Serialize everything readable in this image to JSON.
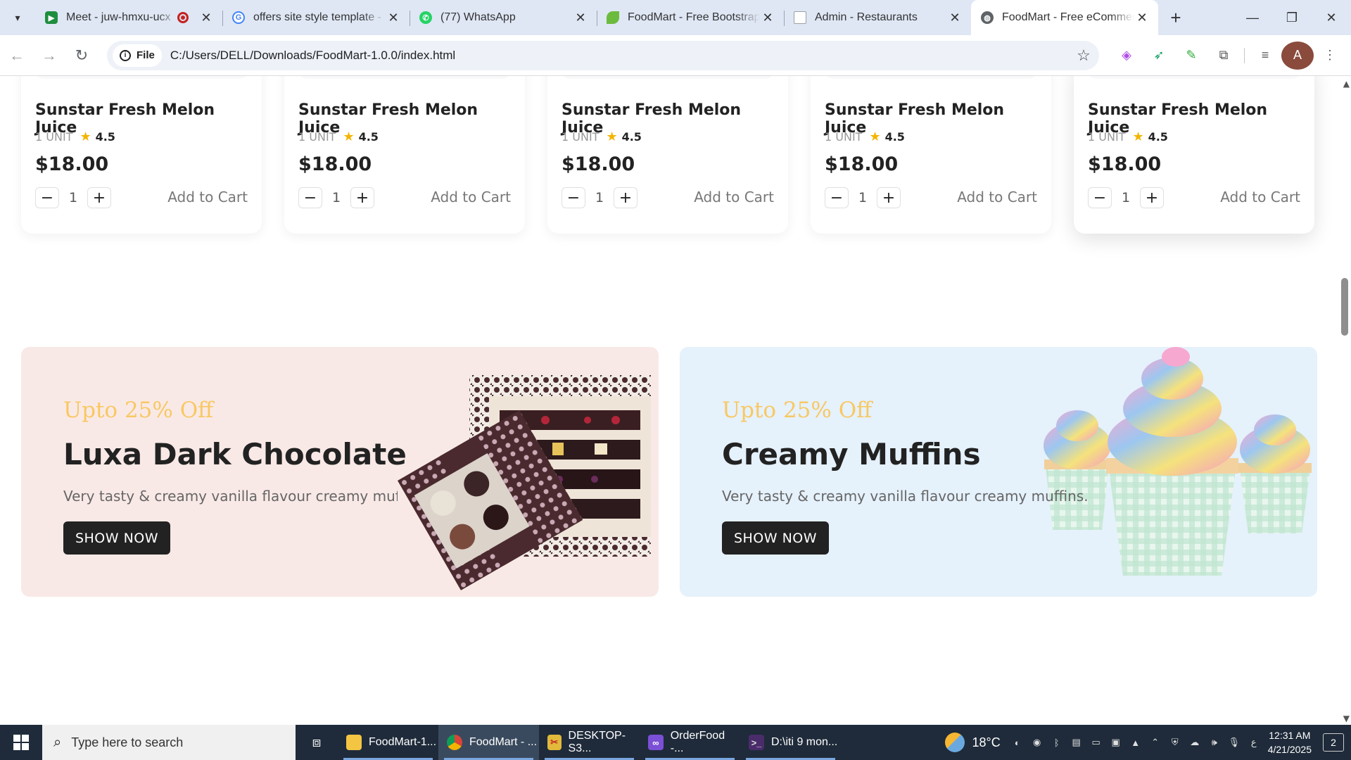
{
  "browser": {
    "tabs": [
      {
        "title": "Meet - juw-hmxu-ucx",
        "favicon": "google-meet-icon",
        "color": "#1e8e3e",
        "recording": true,
        "active": false
      },
      {
        "title": "offers site style template -",
        "favicon": "google-icon",
        "color": "#4285f4",
        "recording": false,
        "active": false
      },
      {
        "title": "(77) WhatsApp",
        "favicon": "whatsapp-icon",
        "color": "#25d366",
        "recording": false,
        "active": false
      },
      {
        "title": "FoodMart - Free Bootstrap",
        "favicon": "foodmart-leaf-icon",
        "color": "#6dbb3e",
        "recording": false,
        "active": false
      },
      {
        "title": "Admin - Restaurants",
        "favicon": "document-icon",
        "color": "#9aa0a6",
        "recording": false,
        "active": false
      },
      {
        "title": "FoodMart - Free eCommerce",
        "favicon": "globe-icon",
        "color": "#5f6368",
        "recording": false,
        "active": true
      }
    ],
    "address": {
      "scheme_chip": "File",
      "url": "C:/Users/DELL/Downloads/FoodMart-1.0.0/index.html"
    },
    "profile_initial": "A"
  },
  "products": [
    {
      "name": "Sunstar Fresh Melon Juice",
      "unit": "1 UNIT",
      "rating": "4.5",
      "price": "$18.00",
      "qty": "1",
      "cta": "Add to Cart"
    },
    {
      "name": "Sunstar Fresh Melon Juice",
      "unit": "1 UNIT",
      "rating": "4.5",
      "price": "$18.00",
      "qty": "1",
      "cta": "Add to Cart"
    },
    {
      "name": "Sunstar Fresh Melon Juice",
      "unit": "1 UNIT",
      "rating": "4.5",
      "price": "$18.00",
      "qty": "1",
      "cta": "Add to Cart"
    },
    {
      "name": "Sunstar Fresh Melon Juice",
      "unit": "1 UNIT",
      "rating": "4.5",
      "price": "$18.00",
      "qty": "1",
      "cta": "Add to Cart"
    },
    {
      "name": "Sunstar Fresh Melon Juice",
      "unit": "1 UNIT",
      "rating": "4.5",
      "price": "$18.00",
      "qty": "1",
      "cta": "Add to Cart"
    }
  ],
  "banners": [
    {
      "offer": "Upto 25% Off",
      "title": "Luxa Dark Chocolate",
      "description": "Very tasty & creamy vanilla flavour creamy muffins.",
      "cta": "SHOW NOW",
      "background": "#f9e9e6",
      "image": "chocolate-box-image"
    },
    {
      "offer": "Upto 25% Off",
      "title": "Creamy Muffins",
      "description": "Very tasty & creamy vanilla flavour creamy muffins.",
      "cta": "SHOW NOW",
      "background": "#e5f1fb",
      "image": "cupcakes-image"
    }
  ],
  "colors": {
    "offer_text": "#f8c862",
    "button_dark": "#222222",
    "rating_star": "#f4b400"
  },
  "taskbar": {
    "search_placeholder": "Type here to search",
    "apps": [
      {
        "label": "FoodMart-1...",
        "icon": "folder-icon",
        "active": false
      },
      {
        "label": "FoodMart - ...",
        "icon": "chrome-icon",
        "active": true
      },
      {
        "label": "DESKTOP-S3...",
        "icon": "remote-desktop-icon",
        "active": false
      },
      {
        "label": "OrderFood -...",
        "icon": "visual-studio-icon",
        "active": false
      },
      {
        "label": "D:\\iti 9 mon...",
        "icon": "terminal-icon",
        "active": false
      }
    ],
    "weather": "18°C",
    "time": "12:31 AM",
    "date": "4/21/2025",
    "notifications": "2"
  }
}
